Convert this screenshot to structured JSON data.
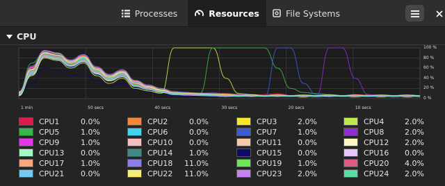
{
  "header": {
    "tabs": [
      {
        "label": "Processes",
        "icon": "list-icon",
        "active": false
      },
      {
        "label": "Resources",
        "icon": "gauge-icon",
        "active": true
      },
      {
        "label": "File Systems",
        "icon": "disk-icon",
        "active": false
      }
    ],
    "menu_icon": "hamburger-menu-icon",
    "close_icon": "close-icon"
  },
  "section": {
    "title": "CPU",
    "toggle_icon": "triangle-down-icon"
  },
  "chart_data": {
    "type": "line",
    "x_labels": [
      "1 min",
      "50 secs",
      "40 secs",
      "30 secs",
      "20 secs",
      "10 secs"
    ],
    "y_labels": [
      "100 %",
      "80 %",
      "60 %",
      "40 %",
      "20 %",
      "0 %"
    ],
    "ylim": [
      0,
      100
    ],
    "grid": true,
    "series": [
      {
        "name": "CPU1",
        "color": "#e01b4c",
        "values": [
          10,
          60,
          95,
          90,
          70,
          85,
          60,
          40,
          55,
          30,
          20,
          15,
          10,
          8,
          10,
          12,
          8,
          6,
          5,
          8,
          10,
          6,
          5,
          4,
          6,
          5,
          8,
          6,
          5,
          4,
          6,
          4
        ]
      },
      {
        "name": "CPU2",
        "color": "#f6853c",
        "values": [
          8,
          55,
          90,
          85,
          75,
          80,
          55,
          45,
          50,
          35,
          25,
          20,
          12,
          10,
          8,
          10,
          10,
          8,
          6,
          6,
          8,
          5,
          4,
          5,
          6,
          5,
          6,
          7,
          4,
          5,
          4,
          5
        ]
      },
      {
        "name": "CPU3",
        "color": "#f9e629",
        "values": [
          5,
          50,
          85,
          80,
          65,
          75,
          50,
          35,
          45,
          25,
          18,
          12,
          8,
          6,
          8,
          6,
          5,
          4,
          5,
          6,
          5,
          4,
          3,
          4,
          5,
          6,
          5,
          4,
          3,
          4,
          5,
          3
        ]
      },
      {
        "name": "CPU4",
        "color": "#bee84f",
        "values": [
          6,
          45,
          80,
          75,
          60,
          70,
          45,
          30,
          40,
          20,
          15,
          10,
          100,
          100,
          100,
          100,
          40,
          10,
          8,
          6,
          5,
          4,
          3,
          5,
          6,
          4,
          3,
          4,
          5,
          6,
          3,
          4
        ]
      },
      {
        "name": "CPU5",
        "color": "#37b54a",
        "values": [
          12,
          70,
          92,
          88,
          72,
          82,
          58,
          38,
          52,
          28,
          22,
          18,
          10,
          12,
          10,
          100,
          100,
          100,
          100,
          100,
          60,
          20,
          12,
          10,
          8,
          6,
          5,
          6,
          4,
          5,
          6,
          5
        ]
      },
      {
        "name": "CPU6",
        "color": "#42d3f0",
        "values": [
          9,
          52,
          88,
          82,
          70,
          78,
          52,
          42,
          48,
          32,
          24,
          14,
          9,
          8,
          9,
          7,
          6,
          5,
          4,
          5,
          6,
          5,
          4,
          6,
          5,
          4,
          5,
          6,
          4,
          3,
          5,
          4
        ]
      },
      {
        "name": "CPU7",
        "color": "#3f5ad3",
        "values": [
          7,
          48,
          86,
          78,
          62,
          72,
          48,
          36,
          44,
          26,
          19,
          13,
          7,
          6,
          7,
          6,
          5,
          4,
          5,
          4,
          100,
          100,
          30,
          8,
          6,
          5,
          4,
          5,
          6,
          4,
          5,
          3
        ]
      },
      {
        "name": "CPU8",
        "color": "#8f2bd1",
        "values": [
          11,
          58,
          93,
          86,
          68,
          80,
          56,
          41,
          51,
          29,
          21,
          16,
          11,
          9,
          8,
          7,
          6,
          5,
          6,
          5,
          6,
          5,
          4,
          5,
          100,
          100,
          40,
          8,
          6,
          5,
          4,
          5
        ]
      },
      {
        "name": "CPU9",
        "color": "#e237e6",
        "values": [
          13,
          62,
          90,
          84,
          74,
          86,
          60,
          44,
          54,
          31,
          23,
          17,
          12,
          10,
          9,
          8,
          7,
          6,
          5,
          6,
          5,
          4,
          5,
          6,
          5,
          4,
          6,
          5,
          4,
          5,
          6,
          4
        ]
      },
      {
        "name": "CPU10",
        "color": "#f5bfc2",
        "values": [
          10,
          56,
          87,
          83,
          69,
          79,
          54,
          39,
          49,
          27,
          20,
          15,
          10,
          9,
          8,
          7,
          6,
          5,
          4,
          5,
          6,
          5,
          4,
          3,
          4,
          5,
          6,
          4,
          5,
          4,
          3,
          4
        ]
      },
      {
        "name": "CPU11",
        "color": "#f5c9a8",
        "values": [
          8,
          50,
          84,
          79,
          66,
          76,
          51,
          37,
          46,
          25,
          19,
          14,
          9,
          8,
          7,
          6,
          5,
          4,
          5,
          4,
          5,
          4,
          5,
          4,
          5,
          6,
          5,
          4,
          5,
          3,
          4,
          5
        ]
      },
      {
        "name": "CPU12",
        "color": "#fdf7c3",
        "values": [
          7,
          47,
          82,
          77,
          64,
          73,
          49,
          35,
          43,
          24,
          18,
          13,
          8,
          7,
          6,
          5,
          4,
          5,
          4,
          5,
          4,
          5,
          4,
          5,
          4,
          5,
          4,
          6,
          5,
          4,
          5,
          4
        ]
      },
      {
        "name": "CPU13",
        "color": "#a3f7c8",
        "values": [
          9,
          53,
          89,
          84,
          71,
          81,
          57,
          43,
          52,
          30,
          22,
          16,
          10,
          9,
          8,
          7,
          6,
          5,
          6,
          5,
          6,
          5,
          6,
          5,
          6,
          5,
          6,
          5,
          4,
          5,
          4,
          5
        ]
      },
      {
        "name": "CPU14",
        "color": "#3c8c85",
        "values": [
          10,
          54,
          88,
          83,
          70,
          80,
          55,
          40,
          50,
          28,
          20,
          15,
          10,
          9,
          8,
          7,
          6,
          5,
          6,
          5,
          6,
          5,
          4,
          5,
          6,
          5,
          4,
          5,
          6,
          5,
          4,
          5
        ]
      },
      {
        "name": "CPU15",
        "color": "#0e0a6c",
        "values": [
          4,
          30,
          60,
          55,
          45,
          50,
          35,
          25,
          30,
          18,
          12,
          9,
          6,
          5,
          4,
          5,
          4,
          3,
          4,
          3,
          4,
          3,
          4,
          3,
          4,
          3,
          4,
          3,
          4,
          3,
          4,
          3
        ]
      },
      {
        "name": "CPU16",
        "color": "#e5c6fa",
        "values": [
          11,
          57,
          91,
          85,
          73,
          83,
          59,
          45,
          53,
          33,
          24,
          17,
          11,
          10,
          9,
          8,
          7,
          6,
          5,
          6,
          5,
          6,
          5,
          6,
          5,
          6,
          5,
          6,
          5,
          6,
          5,
          4
        ]
      },
      {
        "name": "CPU17",
        "color": "#f3a87e",
        "values": [
          12,
          61,
          94,
          89,
          74,
          84,
          61,
          46,
          55,
          34,
          25,
          18,
          12,
          11,
          10,
          9,
          8,
          7,
          6,
          5,
          6,
          5,
          6,
          5,
          6,
          5,
          6,
          5,
          6,
          5,
          6,
          5
        ]
      },
      {
        "name": "CPU18",
        "color": "#8c7ee8",
        "values": [
          14,
          64,
          95,
          90,
          76,
          87,
          63,
          48,
          57,
          36,
          27,
          20,
          14,
          12,
          11,
          10,
          9,
          8,
          7,
          6,
          7,
          6,
          7,
          6,
          7,
          6,
          7,
          6,
          7,
          6,
          7,
          6
        ]
      },
      {
        "name": "CPU19",
        "color": "#6de558",
        "values": [
          9,
          52,
          86,
          81,
          67,
          77,
          53,
          38,
          47,
          26,
          19,
          14,
          9,
          8,
          7,
          6,
          5,
          4,
          5,
          4,
          5,
          4,
          5,
          4,
          5,
          4,
          5,
          4,
          5,
          4,
          5,
          4
        ]
      },
      {
        "name": "CPU20",
        "color": "#e05a86",
        "values": [
          10,
          55,
          88,
          84,
          70,
          80,
          56,
          41,
          51,
          29,
          21,
          15,
          10,
          9,
          8,
          7,
          6,
          5,
          6,
          5,
          6,
          5,
          6,
          5,
          6,
          5,
          6,
          5,
          6,
          5,
          6,
          5
        ]
      },
      {
        "name": "CPU21",
        "color": "#74c9f2",
        "values": [
          8,
          49,
          83,
          78,
          64,
          74,
          50,
          36,
          45,
          24,
          18,
          13,
          8,
          7,
          6,
          5,
          4,
          5,
          4,
          5,
          4,
          5,
          4,
          5,
          4,
          5,
          4,
          5,
          4,
          5,
          4,
          5
        ]
      },
      {
        "name": "CPU22",
        "color": "#f6ef75",
        "values": [
          11,
          58,
          90,
          86,
          71,
          81,
          57,
          42,
          51,
          30,
          22,
          16,
          11,
          10,
          9,
          8,
          7,
          6,
          7,
          6,
          7,
          6,
          7,
          6,
          7,
          6,
          7,
          6,
          7,
          6,
          7,
          6
        ]
      },
      {
        "name": "CPU23",
        "color": "#c582f2",
        "values": [
          9,
          51,
          85,
          80,
          66,
          76,
          52,
          37,
          46,
          25,
          19,
          14,
          9,
          8,
          7,
          6,
          5,
          6,
          5,
          6,
          5,
          6,
          5,
          6,
          5,
          6,
          5,
          6,
          5,
          6,
          5,
          6
        ]
      },
      {
        "name": "CPU24",
        "color": "#58dca2",
        "values": [
          10,
          54,
          87,
          82,
          69,
          79,
          55,
          40,
          49,
          27,
          20,
          15,
          10,
          9,
          8,
          7,
          6,
          5,
          6,
          5,
          6,
          5,
          6,
          5,
          6,
          5,
          6,
          5,
          6,
          5,
          6,
          5
        ]
      }
    ]
  },
  "legend": [
    {
      "name": "CPU1",
      "value": "0.0%",
      "color": "#e01b4c"
    },
    {
      "name": "CPU2",
      "value": "0.0%",
      "color": "#f6853c"
    },
    {
      "name": "CPU3",
      "value": "2.0%",
      "color": "#f9e629"
    },
    {
      "name": "CPU4",
      "value": "2.0%",
      "color": "#bee84f"
    },
    {
      "name": "CPU5",
      "value": "1.0%",
      "color": "#37b54a"
    },
    {
      "name": "CPU6",
      "value": "0.0%",
      "color": "#42d3f0"
    },
    {
      "name": "CPU7",
      "value": "1.0%",
      "color": "#3f5ad3"
    },
    {
      "name": "CPU8",
      "value": "2.0%",
      "color": "#8f2bd1"
    },
    {
      "name": "CPU9",
      "value": "1.0%",
      "color": "#e237e6"
    },
    {
      "name": "CPU10",
      "value": "0.0%",
      "color": "#f5bfc2"
    },
    {
      "name": "CPU11",
      "value": "0.0%",
      "color": "#f5c9a8"
    },
    {
      "name": "CPU12",
      "value": "2.0%",
      "color": "#fdf7c3"
    },
    {
      "name": "CPU13",
      "value": "0.0%",
      "color": "#a3f7c8"
    },
    {
      "name": "CPU14",
      "value": "1.0%",
      "color": "#3c8c85"
    },
    {
      "name": "CPU15",
      "value": "0.0%",
      "color": "#0e0a6c"
    },
    {
      "name": "CPU16",
      "value": "0.0%",
      "color": "#e5c6fa"
    },
    {
      "name": "CPU17",
      "value": "1.0%",
      "color": "#f3a87e"
    },
    {
      "name": "CPU18",
      "value": "11.0%",
      "color": "#8c7ee8"
    },
    {
      "name": "CPU19",
      "value": "1.0%",
      "color": "#6de558"
    },
    {
      "name": "CPU20",
      "value": "4.0%",
      "color": "#e05a86"
    },
    {
      "name": "CPU21",
      "value": "0.0%",
      "color": "#74c9f2"
    },
    {
      "name": "CPU22",
      "value": "11.0%",
      "color": "#f6ef75"
    },
    {
      "name": "CPU23",
      "value": "2.0%",
      "color": "#c582f2"
    },
    {
      "name": "CPU24",
      "value": "2.0%",
      "color": "#58dca2"
    }
  ]
}
